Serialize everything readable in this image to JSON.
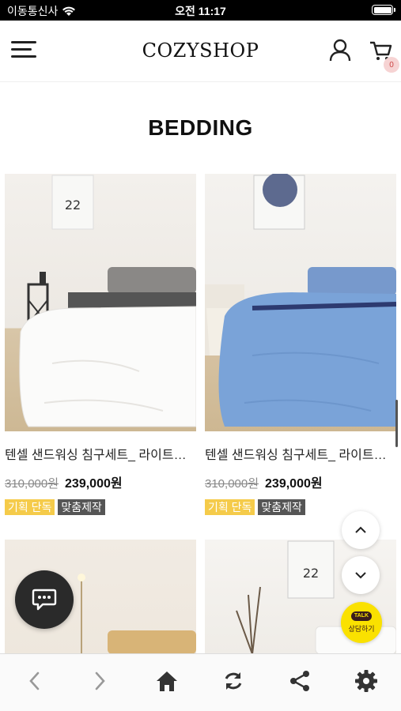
{
  "status_bar": {
    "carrier": "이동통신사",
    "time": "오전 11:17"
  },
  "header": {
    "logo": "COZYSHOP",
    "cart_count": "0"
  },
  "page": {
    "title": "BEDDING"
  },
  "products": [
    {
      "name": "텐셀 샌드워싱 침구세트_ 라이트그레이",
      "old_price": "310,000원",
      "new_price": "239,000원",
      "tags": [
        "기획 단독",
        "맞춤제작"
      ]
    },
    {
      "name": "텐셀 샌드워싱 침구세트_ 라이트블루",
      "old_price": "310,000원",
      "new_price": "239,000원",
      "tags": [
        "기획 단독",
        "맞춤제작"
      ]
    }
  ],
  "floating": {
    "talk_bubble": "TALK",
    "talk_label": "상담하기"
  },
  "colors": {
    "tag_yellow": "#f5cb4a",
    "tag_dark": "#555555",
    "kakao_yellow": "#fae100"
  },
  "icons": [
    "menu-icon",
    "user-icon",
    "cart-icon",
    "chat-icon",
    "chevron-up-icon",
    "chevron-down-icon",
    "back-icon",
    "forward-icon",
    "home-icon",
    "refresh-icon",
    "share-icon",
    "settings-icon"
  ]
}
